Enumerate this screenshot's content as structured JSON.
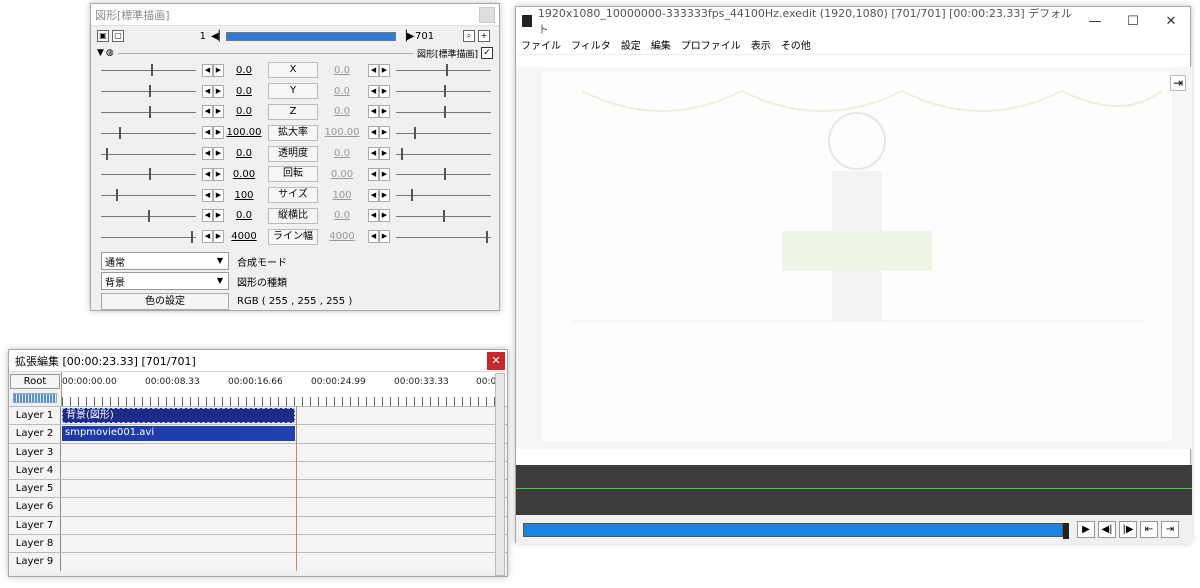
{
  "object_window": {
    "title": "図形[標準描画]",
    "frame_start": "1",
    "frame_end": "701",
    "filter_label": "図形[標準描画]",
    "params": [
      {
        "name": "X",
        "left": "0.0",
        "right": "0.0"
      },
      {
        "name": "Y",
        "left": "0.0",
        "right": "0.0"
      },
      {
        "name": "Z",
        "left": "0.0",
        "right": "0.0"
      },
      {
        "name": "拡大率",
        "left": "100.00",
        "right": "100.00"
      },
      {
        "name": "透明度",
        "left": "0.0",
        "right": "0.0"
      },
      {
        "name": "回転",
        "left": "0.00",
        "right": "0.00"
      },
      {
        "name": "サイズ",
        "left": "100",
        "right": "100"
      },
      {
        "name": "縦横比",
        "left": "0.0",
        "right": "0.0"
      },
      {
        "name": "ライン幅",
        "left": "4000",
        "right": "4000"
      }
    ],
    "blend_mode_value": "通常",
    "blend_mode_label": "合成モード",
    "shape_type_value": "背景",
    "shape_type_label": "図形の種類",
    "color_button": "色の設定",
    "color_value": "RGB ( 255 , 255 , 255 )"
  },
  "timeline_window": {
    "title": "拡張編集 [00:00:23.33] [701/701]",
    "root_label": "Root",
    "ticks": [
      "00:00:00.00",
      "00:00:08.33",
      "00:00:16.66",
      "00:00:24.99",
      "00:00:33.33",
      "00:0"
    ],
    "layers": [
      "Layer 1",
      "Layer 2",
      "Layer 3",
      "Layer 4",
      "Layer 5",
      "Layer 6",
      "Layer 7",
      "Layer 8",
      "Layer 9"
    ],
    "clips": [
      {
        "layer": 1,
        "label": "背景(図形)"
      },
      {
        "layer": 2,
        "label": "smpmovie001.avi"
      }
    ]
  },
  "main_window": {
    "title": "1920x1080_10000000-333333fps_44100Hz.exedit (1920,1080)  [701/701]  [00:00:23.33]  デフォルト",
    "menu": [
      "ファイル",
      "フィルタ",
      "設定",
      "編集",
      "プロファイル",
      "表示",
      "その他"
    ]
  }
}
